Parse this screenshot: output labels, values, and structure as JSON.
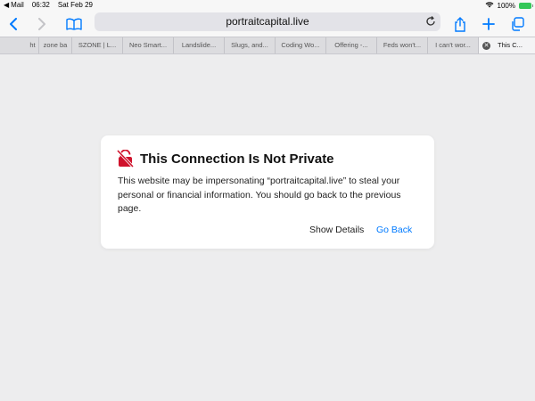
{
  "status_bar": {
    "back_app": "Mail",
    "time": "06:32",
    "date": "Sat Feb 29",
    "battery": "100%"
  },
  "toolbar": {
    "url": "portraitcapital.live"
  },
  "tabs": [
    {
      "label": "ht"
    },
    {
      "label": "zone ba"
    },
    {
      "label": "SZONE | L..."
    },
    {
      "label": "Neo Smart..."
    },
    {
      "label": "Landslide..."
    },
    {
      "label": "Slugs, and..."
    },
    {
      "label": "Coding Wo..."
    },
    {
      "label": "Offering -..."
    },
    {
      "label": "Feds won't..."
    },
    {
      "label": "I can't wor..."
    },
    {
      "label": "This C..."
    }
  ],
  "warning": {
    "title": "This Connection Is Not Private",
    "body": "This website may be impersonating “portraitcapital.live” to steal your personal or financial information. You should go back to the previous page.",
    "show_details": "Show Details",
    "go_back": "Go Back"
  },
  "colors": {
    "accent": "#007aff",
    "warning": "#d0112b"
  }
}
